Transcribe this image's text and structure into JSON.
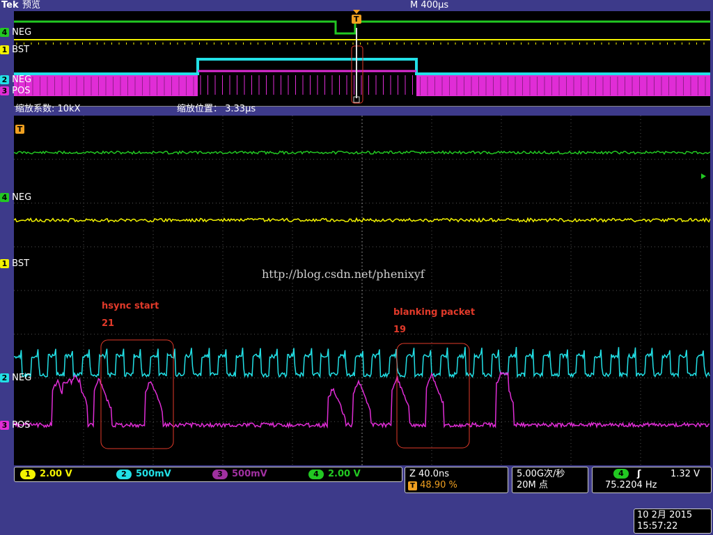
{
  "header": {
    "brand": "Tek",
    "mode": "预览",
    "timebase": "M 400µs"
  },
  "overview": {
    "trigger_marker": "T",
    "channel_labels": [
      {
        "num": "4",
        "name": "NEG"
      },
      {
        "num": "1",
        "name": "BST"
      },
      {
        "num": "2",
        "name": "NEG"
      },
      {
        "num": "3",
        "name": "POS"
      }
    ]
  },
  "zoom": {
    "factor_label": "缩放系数: 10kX",
    "position_label": "缩放位置：  3.33µs"
  },
  "main": {
    "trigger_marker": "T",
    "channel_labels": [
      {
        "num": "4",
        "name": "NEG"
      },
      {
        "num": "1",
        "name": "BST"
      },
      {
        "num": "2",
        "name": "NEG"
      },
      {
        "num": "3",
        "name": "POS"
      }
    ],
    "watermark": "http://blog.csdn.net/phenixyf",
    "annotations": [
      {
        "title": "hsync start",
        "count": "21"
      },
      {
        "title": "blanking packet",
        "count": "19"
      }
    ]
  },
  "channels": [
    {
      "num": "1",
      "scale": "2.00 V",
      "color": "#f2f200"
    },
    {
      "num": "2",
      "scale": "500mV",
      "color": "#22e0e6"
    },
    {
      "num": "3",
      "scale": "500mV",
      "color": "#e02dd6"
    },
    {
      "num": "4",
      "scale": "2.00 V",
      "color": "#22c822"
    }
  ],
  "zoom_info": {
    "z_label": "Z 40.0ns",
    "trigger_pos": "48.90 %",
    "trigger_badge": "T"
  },
  "acquisition": {
    "rate": "5.00G次/秒",
    "points": "20M 点"
  },
  "trigger": {
    "channel": "4",
    "slope": "ʃ",
    "level": "1.32 V",
    "frequency": "75.2204 Hz"
  },
  "datetime": {
    "date": "10 2月  2015",
    "time": "15:57:22"
  },
  "colors": {
    "ch1": "#f2f200",
    "ch2": "#22e0e6",
    "ch3": "#e02dd6",
    "ch4": "#22c822",
    "background": "#3d3a8a",
    "annotation": "#e23a2a"
  }
}
